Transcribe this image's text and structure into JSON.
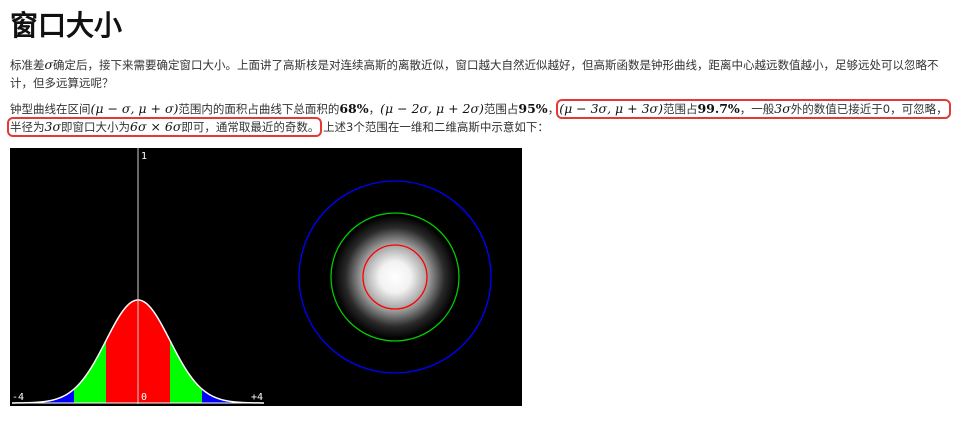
{
  "title": "窗口大小",
  "p1": {
    "a": "标准差",
    "sigma": "σ",
    "b": "确定后，接下来需要确定窗口大小。上面讲了高斯核是对连续高斯的离散近似，窗口越大自然近似越好，但高斯函数是钟形曲线，距离中心越远数值越小，足够远处可以忽略不计，但多远算远呢？"
  },
  "p2": {
    "a": "钟型曲线在区间",
    "int1": "(μ − σ, μ + σ)",
    "b": "范围内的面积占曲线下总面积的",
    "pct1": "68%",
    "c": "，",
    "int2": "(μ − 2σ, μ + 2σ)",
    "d": "范围占",
    "pct2": "95%",
    "e": "，",
    "int3": "(μ − 3σ, μ + 3σ)",
    "f": "范围占",
    "pct3": "99.7%",
    "g": "，一般",
    "three_sigma": "3σ",
    "h": "外的数值已接近于0，可忽略，",
    "i": "半径为",
    "radius": "3σ",
    "j": "即窗口大小为",
    "size": "6σ × 6σ",
    "k": "即可，通常取最近的奇数。",
    "l": "上述3个范围在一维和二维高斯中示意如下："
  },
  "figure": {
    "tick_left": "-4",
    "tick_center": "0",
    "tick_right": "+4",
    "tick_top": "1",
    "colors": {
      "band_1sigma": "#ff0000",
      "band_2sigma": "#00ff00",
      "band_3sigma": "#0000ff",
      "background": "#000000"
    },
    "circles": [
      {
        "name": "1-sigma",
        "color": "#ff0000"
      },
      {
        "name": "2-sigma",
        "color": "#00cc00"
      },
      {
        "name": "3-sigma",
        "color": "#0000ff"
      }
    ]
  }
}
